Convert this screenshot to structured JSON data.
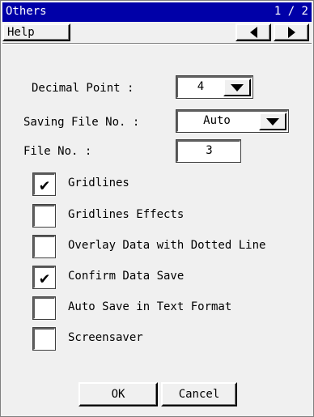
{
  "dialog": {
    "title": "Others",
    "page_indicator": "1 / 2",
    "help_label": "Help",
    "prev_icon": "left-triangle-icon",
    "next_icon": "right-triangle-icon"
  },
  "fields": {
    "decimal_point": {
      "label": "Decimal Point :",
      "value": "4"
    },
    "saving_file_no": {
      "label": "Saving File No. :",
      "value": "Auto"
    },
    "file_no": {
      "label": "File No. :",
      "value": "3"
    }
  },
  "options": [
    {
      "label": "Gridlines",
      "checked": true
    },
    {
      "label": "Gridlines Effects",
      "checked": false
    },
    {
      "label": "Overlay Data with Dotted Line",
      "checked": false
    },
    {
      "label": "Confirm Data Save",
      "checked": true
    },
    {
      "label": "Auto Save in Text Format",
      "checked": false
    },
    {
      "label": "Screensaver",
      "checked": false
    }
  ],
  "footer": {
    "ok_label": "OK",
    "cancel_label": "Cancel"
  },
  "colors": {
    "title_bar": "#0000a8",
    "panel": "#f0f0f0"
  }
}
